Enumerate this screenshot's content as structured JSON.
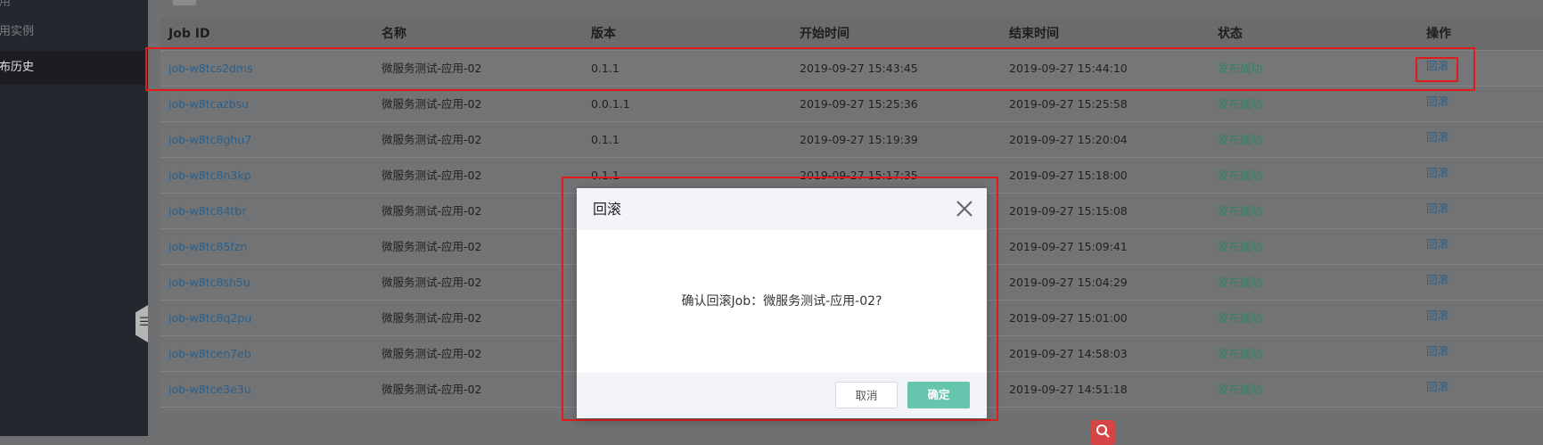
{
  "sidebar": {
    "items": [
      {
        "label": "应用"
      },
      {
        "label": "应用实例"
      },
      {
        "label": "发布历史"
      }
    ]
  },
  "table": {
    "columns": [
      "Job ID",
      "名称",
      "版本",
      "开始时间",
      "结束时间",
      "状态",
      "操作"
    ],
    "rows": [
      {
        "job_id": "job-w8tcs2dms",
        "name": "微服务测试-应用-02",
        "version": "0.1.1",
        "start": "2019-09-27 15:43:45",
        "end": "2019-09-27 15:44:10",
        "status": "发布成功",
        "action": "回滚"
      },
      {
        "job_id": "job-w8tcazbsu",
        "name": "微服务测试-应用-02",
        "version": "0.0.1.1",
        "start": "2019-09-27 15:25:36",
        "end": "2019-09-27 15:25:58",
        "status": "发布成功",
        "action": "回滚"
      },
      {
        "job_id": "job-w8tc8ghu7",
        "name": "微服务测试-应用-02",
        "version": "0.1.1",
        "start": "2019-09-27 15:19:39",
        "end": "2019-09-27 15:20:04",
        "status": "发布成功",
        "action": "回滚"
      },
      {
        "job_id": "job-w8tc8n3kp",
        "name": "微服务测试-应用-02",
        "version": "0.1.1",
        "start": "2019-09-27 15:17:35",
        "end": "2019-09-27 15:18:00",
        "status": "发布成功",
        "action": "回滚"
      },
      {
        "job_id": "job-w8tc84tbr",
        "name": "微服务测试-应用-02",
        "version": "",
        "start": "",
        "end": "2019-09-27 15:15:08",
        "status": "发布成功",
        "action": "回滚"
      },
      {
        "job_id": "job-w8tc85fzn",
        "name": "微服务测试-应用-02",
        "version": "",
        "start": "",
        "end": "2019-09-27 15:09:41",
        "status": "发布成功",
        "action": "回滚"
      },
      {
        "job_id": "job-w8tc8sh5u",
        "name": "微服务测试-应用-02",
        "version": "",
        "start": "",
        "end": "2019-09-27 15:04:29",
        "status": "发布成功",
        "action": "回滚"
      },
      {
        "job_id": "job-w8tc8q2pu",
        "name": "微服务测试-应用-02",
        "version": "",
        "start": "",
        "end": "2019-09-27 15:01:00",
        "status": "发布成功",
        "action": "回滚"
      },
      {
        "job_id": "job-w8tcen7eb",
        "name": "微服务测试-应用-02",
        "version": "",
        "start": "",
        "end": "2019-09-27 14:58:03",
        "status": "发布成功",
        "action": "回滚"
      },
      {
        "job_id": "job-w8tce3e3u",
        "name": "微服务测试-应用-02",
        "version": "",
        "start": "",
        "end": "2019-09-27 14:51:18",
        "status": "发布成功",
        "action": "回滚"
      }
    ]
  },
  "modal": {
    "title": "回滚",
    "message": "确认回滚Job：微服务测试-应用-02?",
    "cancel_label": "取消",
    "confirm_label": "确定"
  },
  "side_handle": {
    "glyph": "☰"
  },
  "icons": {
    "close": "close-icon",
    "search": "search-icon",
    "menu": "menu-icon"
  },
  "colors": {
    "link": "#2d5f88",
    "success": "#2f8260",
    "confirm_button": "#65c6ad",
    "highlight_box": "#e01b1b",
    "sidebar_bg": "#24272d"
  }
}
